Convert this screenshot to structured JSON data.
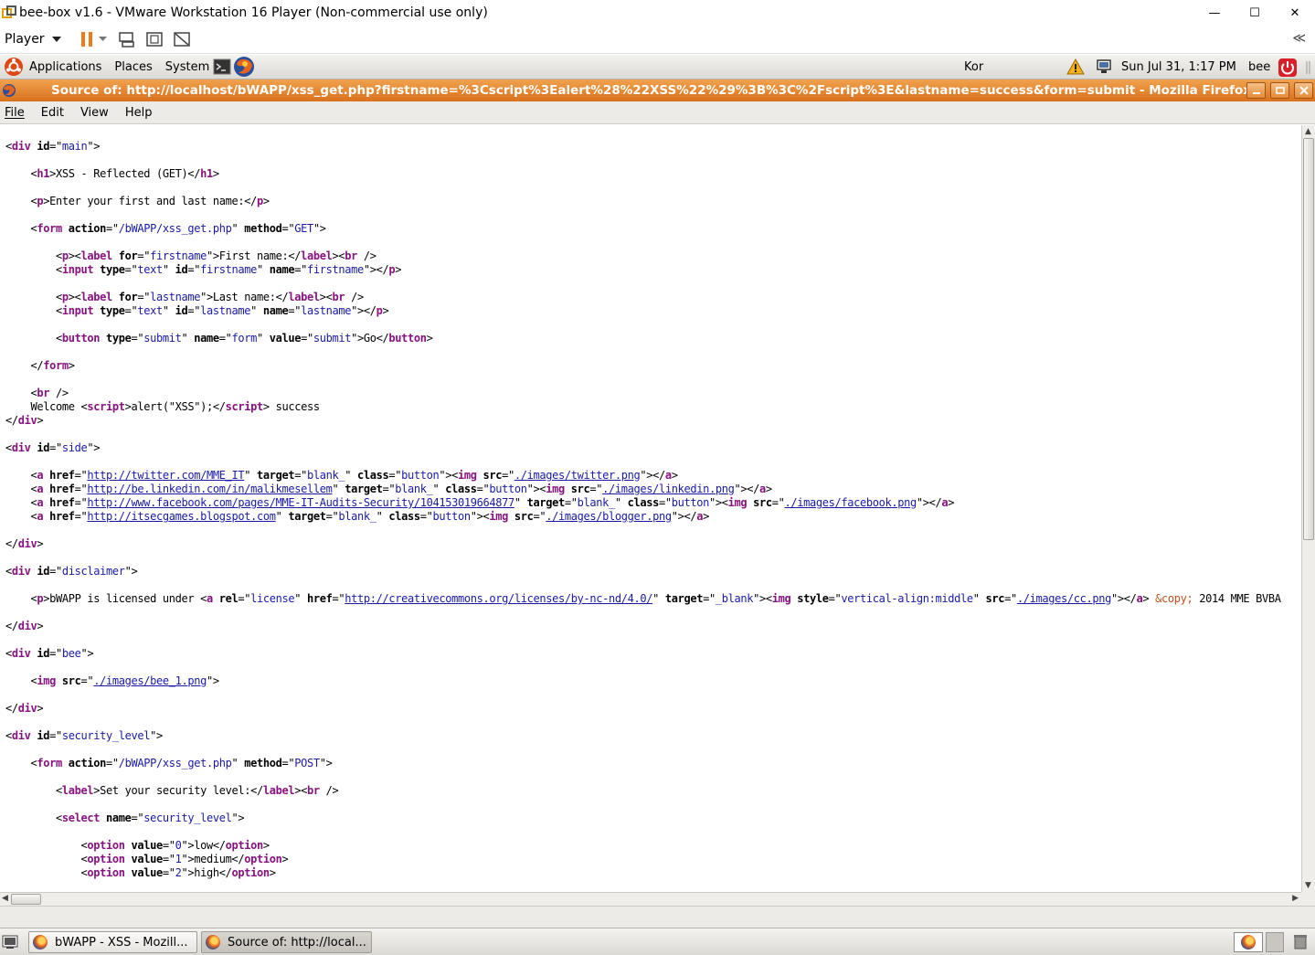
{
  "vmware": {
    "title": "bee-box v1.6 - VMware Workstation 16 Player (Non-commercial use only)",
    "player_menu": "Player",
    "window_controls": {
      "minimize": "—",
      "maximize": "☐",
      "close": "✕"
    },
    "collapse_glyph": "≪"
  },
  "gnome_panel": {
    "applications": "Applications",
    "places": "Places",
    "system": "System",
    "keyboard": "Kor",
    "clock": "Sun Jul 31,  1:17 PM",
    "user": "bee"
  },
  "firefox": {
    "title": "Source of: http://localhost/bWAPP/xss_get.php?firstname=%3Cscript%3Ealert%28%22XSS%22%29%3B%3C%2Fscript%3E&lastname=success&form=submit - Mozilla Firefox",
    "menu": {
      "file": "File",
      "edit": "Edit",
      "view": "View",
      "help": "Help"
    }
  },
  "source": {
    "main_id": "main",
    "h1": "XSS - Reflected (GET)",
    "intro": "Enter your first and last name:",
    "form_action": "/bWAPP/xss_get.php",
    "form_method": "GET",
    "firstname_label": "First name:",
    "firstname_id": "firstname",
    "lastname_label": "Last name:",
    "lastname_id": "lastname",
    "input_type": "text",
    "button_type": "submit",
    "button_name": "form",
    "button_value": "submit",
    "button_text": "Go",
    "welcome": "Welcome ",
    "script_body": "alert(\"XSS\");",
    "success": " success",
    "side_id": "side",
    "target_blank_": "blank_",
    "class_button": "button",
    "twitter_href": "http://twitter.com/MME_IT",
    "twitter_img": "./images/twitter.png",
    "linkedin_href": "http://be.linkedin.com/in/malikmesellem",
    "linkedin_img": "./images/linkedin.png",
    "facebook_href": "http://www.facebook.com/pages/MME-IT-Audits-Security/104153019664877",
    "facebook_img": "./images/facebook.png",
    "blogger_href": "http://itsecgames.blogspot.com",
    "blogger_img": "./images/blogger.png",
    "disclaimer_id": "disclaimer",
    "license_prefix": "bWAPP is licensed under ",
    "license_rel": "license",
    "license_href": "http://creativecommons.org/licenses/by-nc-nd/4.0/",
    "license_target": "_blank",
    "license_style": "vertical-align:middle",
    "license_img": "./images/cc.png",
    "copy_entity": "&copy;",
    "license_suffix": " 2014 MME BVBA",
    "bee_id": "bee",
    "bee_img": "./images/bee_1.png",
    "security_id": "security_level",
    "security_method": "POST",
    "security_label": "Set your security level:",
    "select_name": "security_level",
    "options": [
      {
        "value": "0",
        "text": "low"
      },
      {
        "value": "1",
        "text": "medium"
      },
      {
        "value": "2",
        "text": "high"
      }
    ]
  },
  "taskbar": {
    "tasks": [
      {
        "label": "bWAPP - XSS - Mozill..."
      },
      {
        "label": "Source of: http://local..."
      }
    ]
  }
}
